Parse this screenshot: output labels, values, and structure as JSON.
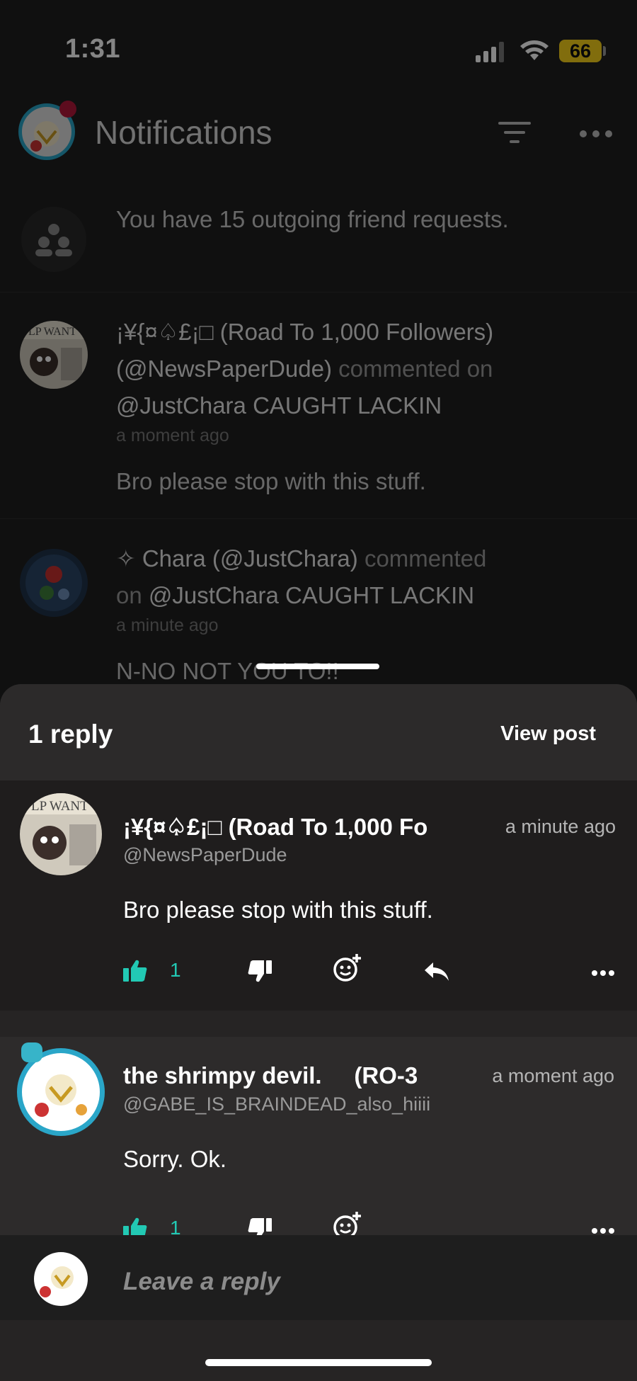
{
  "status_bar": {
    "time": "1:31",
    "battery": "66"
  },
  "header": {
    "title": "Notifications"
  },
  "notifications": [
    {
      "type": "friend_requests",
      "text": "You have 15 outgoing friend requests."
    },
    {
      "actor": "¡¥{¤♤£¡□ (Road To 1,000 Followers)",
      "handle": "(@NewsPaperDude)",
      "action": "commented on",
      "target": "@JustChara CAUGHT LACKIN",
      "time": "a moment ago",
      "body": "Bro please stop with this stuff."
    },
    {
      "badge": "✧",
      "actor": "Chara (@JustChara)",
      "action": "commented",
      "action2": "on",
      "target": "@JustChara CAUGHT LACKIN",
      "time": "a minute ago",
      "body": "N-NO NOT YOU TO!!"
    }
  ],
  "sheet": {
    "reply_count": "1 reply",
    "view_post": "View post",
    "comments": [
      {
        "name": "¡¥{¤♤£¡□ (Road To 1,000 Fo",
        "handle": "@NewsPaperDude",
        "time": "a minute ago",
        "text": "Bro please stop with this stuff.",
        "likes": "1"
      },
      {
        "name": "the shrimpy devil.     (RO-3",
        "handle": "@GABE_IS_BRAINDEAD_also_hiiii",
        "time": "a moment ago",
        "text": "Sorry. Ok.",
        "likes": "1"
      }
    ],
    "reply_placeholder": "Leave a reply"
  },
  "colors": {
    "accent": "#22c9b4",
    "sheet": "#262424",
    "battery": "#f7d21a"
  }
}
